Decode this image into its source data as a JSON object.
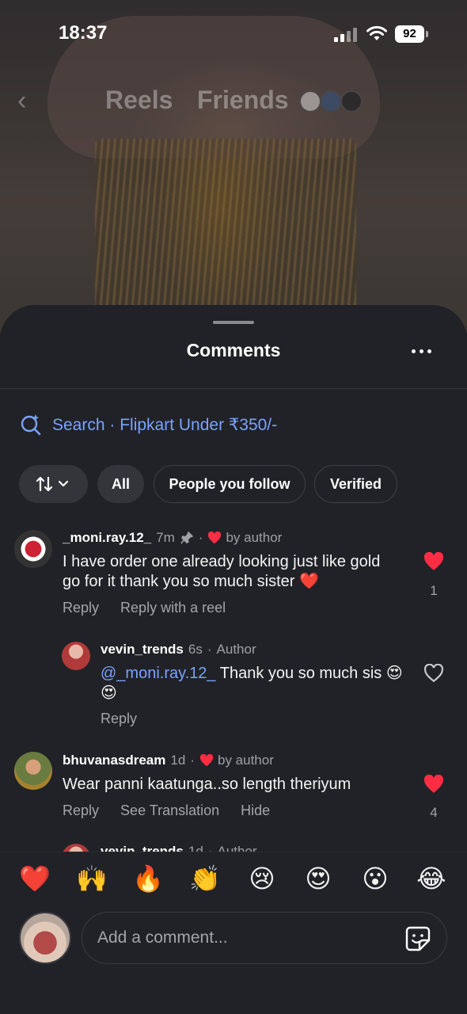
{
  "status": {
    "time": "18:37",
    "battery": "92"
  },
  "nav": {
    "tabs": [
      "Reels",
      "Friends"
    ]
  },
  "sheet": {
    "title": "Comments",
    "search": "Search · Flipkart Under ₹350/-",
    "filters": [
      "All",
      "People you follow",
      "Verified"
    ]
  },
  "comments": [
    {
      "username": "_moni.ray.12_",
      "time": "7m",
      "liked_by_author": "by author",
      "text": "I have order one already looking just like gold  go for it thank you so much sister ❤️",
      "actions": [
        "Reply",
        "Reply with a reel"
      ],
      "likes": "1",
      "liked": true
    },
    {
      "username": "vevin_trends",
      "time": "6s",
      "tag": "Author",
      "mention": "@_moni.ray.12_",
      "text": " Thank you so much sis 😍😍",
      "actions": [
        "Reply"
      ],
      "liked": false
    },
    {
      "username": "bhuvanasdream",
      "time": "1d",
      "liked_by_author": "by author",
      "text": "Wear panni kaatunga..so length theriyum",
      "actions": [
        "Reply",
        "See Translation",
        "Hide"
      ],
      "likes": "4",
      "liked": true
    },
    {
      "username": "vevin_trends",
      "time": "1d",
      "tag": "Author"
    }
  ],
  "emoji_bar": [
    "❤️",
    "🙌",
    "🔥",
    "👏",
    "😢",
    "😍",
    "😮",
    "😂"
  ],
  "composer": {
    "placeholder": "Add a comment..."
  },
  "colors": {
    "accent_link": "#7aa2ff",
    "heart": "#ff2d44",
    "sheet_bg": "#212227"
  }
}
